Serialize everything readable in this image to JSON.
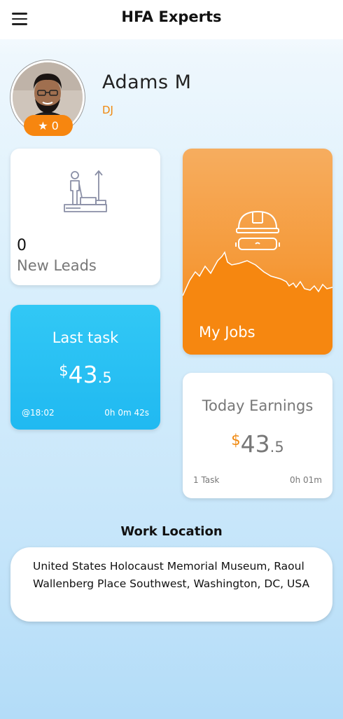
{
  "header": {
    "title": "HFA Experts",
    "menu_icon": "hamburger-menu-icon"
  },
  "profile": {
    "name": "Adams M",
    "role": "DJ",
    "rating": "0",
    "rating_icon": "star-icon"
  },
  "cards": {
    "leads": {
      "count": "0",
      "label": "New Leads",
      "icon": "worker-chart-icon"
    },
    "jobs": {
      "label": "My Jobs",
      "icon": "hardhat-goggles-icon"
    },
    "last_task": {
      "title": "Last task",
      "currency": "$",
      "amount": "43",
      "decimal": ".5",
      "time": "@18:02",
      "duration": "0h 0m 42s"
    },
    "earnings": {
      "title": "Today Earnings",
      "currency": "$",
      "amount": "43",
      "decimal": ".5",
      "tasks": "1 Task",
      "duration": "0h 01m"
    }
  },
  "location": {
    "title": "Work Location",
    "address": "United States Holocaust Memorial Museum, Raoul Wallenberg Place Southwest, Washington, DC, USA"
  },
  "colors": {
    "accent_orange": "#f68710",
    "accent_blue": "#20b9f1"
  }
}
